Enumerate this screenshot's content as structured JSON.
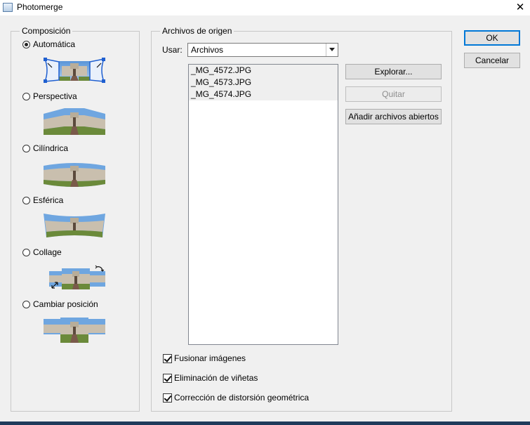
{
  "window": {
    "title": "Photomerge",
    "close_glyph": "✕"
  },
  "layout_group": {
    "legend": "Composición",
    "options": [
      {
        "label": "Automática",
        "selected": true,
        "icon": "auto-layout-icon"
      },
      {
        "label": "Perspectiva",
        "selected": false,
        "icon": "perspective-layout-icon"
      },
      {
        "label": "Cilíndrica",
        "selected": false,
        "icon": "cylindrical-layout-icon"
      },
      {
        "label": "Esférica",
        "selected": false,
        "icon": "spherical-layout-icon"
      },
      {
        "label": "Collage",
        "selected": false,
        "icon": "collage-layout-icon"
      },
      {
        "label": "Cambiar posición",
        "selected": false,
        "icon": "reposition-layout-icon"
      }
    ]
  },
  "source_group": {
    "legend": "Archivos de origen",
    "use_label": "Usar:",
    "use_value": "Archivos",
    "files": [
      "_MG_4572.JPG",
      "_MG_4573.JPG",
      "_MG_4574.JPG"
    ],
    "browse_label": "Explorar...",
    "remove_label": "Quitar",
    "add_open_label": "Añadir archivos abiertos"
  },
  "options": [
    {
      "label": "Fusionar imágenes",
      "checked": true
    },
    {
      "label": "Eliminación de viñetas",
      "checked": true
    },
    {
      "label": "Corrección de distorsión geométrica",
      "checked": true
    }
  ],
  "buttons": {
    "ok": "OK",
    "cancel": "Cancelar"
  },
  "colors": {
    "sky": "#6fa6e0",
    "grass": "#6b8a3a",
    "building": "#c9bfae",
    "path": "#7a5a4a",
    "focus": "#0078d7"
  }
}
